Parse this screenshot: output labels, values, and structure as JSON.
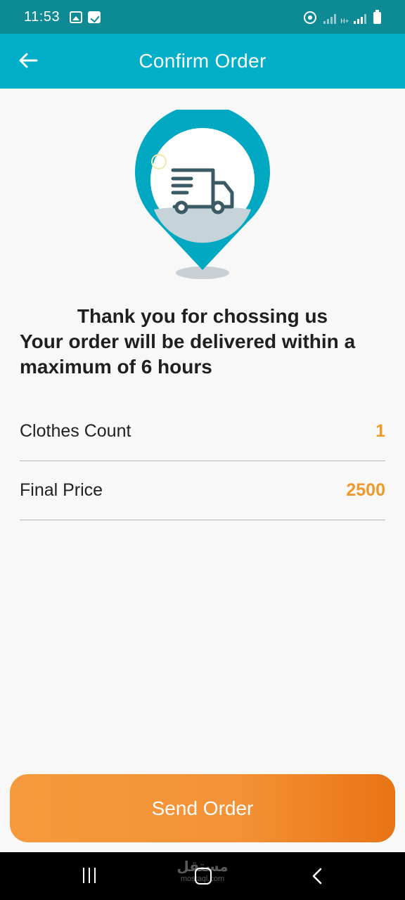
{
  "status_bar": {
    "time": "11:53",
    "left_icons": [
      "gallery-icon",
      "checkbox-icon"
    ],
    "right_icons": [
      "hotspot-icon",
      "signal-icon",
      "ht-signal-icon",
      "signal-icon",
      "battery-icon"
    ],
    "ht_label": "H+"
  },
  "app_bar": {
    "title": "Confirm Order",
    "back_icon": "arrow-left-icon",
    "color": "#00aec7"
  },
  "illustration": {
    "icon": "delivery-truck-location-pin-icon",
    "pin_color": "#00a8c2"
  },
  "message": {
    "line1": "Thank you for chossing us",
    "line2": "Your order will be delivered within a maximum of 6 hours"
  },
  "summary": {
    "rows": [
      {
        "label": "Clothes Count",
        "value": "1"
      },
      {
        "label": "Final Price",
        "value": "2500"
      }
    ],
    "value_color": "#f09a2a"
  },
  "send_button": {
    "label": "Send Order",
    "color": "#f39136"
  },
  "nav_bar": {
    "watermark_main": "مستقل",
    "watermark_sub": "mostaql.com"
  }
}
